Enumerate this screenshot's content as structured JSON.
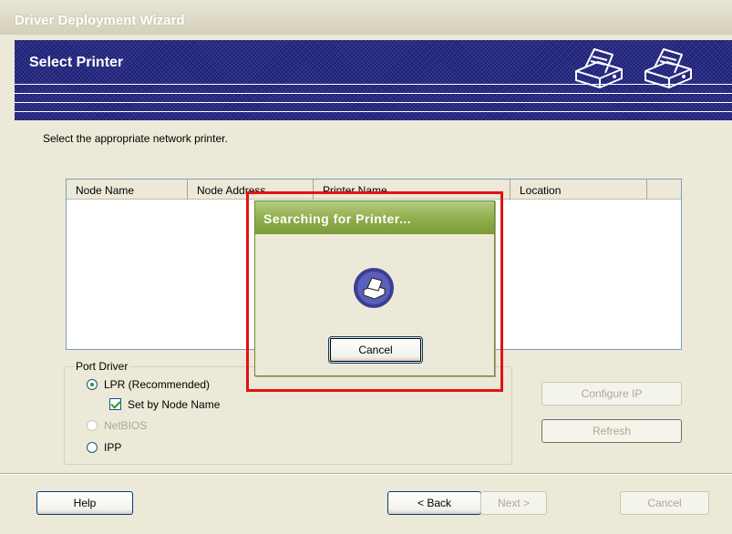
{
  "window": {
    "title": "Driver Deployment Wizard"
  },
  "banner": {
    "title": "Select Printer",
    "icons": [
      "printer-icon",
      "printer-icon"
    ]
  },
  "instruction": "Select the appropriate network printer.",
  "list": {
    "columns": [
      "Node Name",
      "Node Address",
      "Printer Name",
      "Location"
    ],
    "rows": []
  },
  "port_driver": {
    "label": "Port Driver",
    "options": [
      {
        "label": "LPR (Recommended)",
        "selected": true,
        "enabled": true
      },
      {
        "label": "NetBIOS",
        "selected": false,
        "enabled": false
      },
      {
        "label": "IPP",
        "selected": false,
        "enabled": true
      }
    ],
    "set_by_node_name": {
      "label": "Set by Node Name",
      "checked": true
    }
  },
  "buttons": {
    "configure_ip": "Configure IP",
    "refresh": "Refresh",
    "help": "Help",
    "back": "< Back",
    "next": "Next >",
    "cancel": "Cancel"
  },
  "popup": {
    "title": "Searching for Printer...",
    "cancel": "Cancel",
    "icon": "printer-icon"
  },
  "colors": {
    "banner": "#1c1f78",
    "popup_title": "#8fad4a",
    "highlight": "#e21313",
    "window_bg": "#ece9d8"
  }
}
